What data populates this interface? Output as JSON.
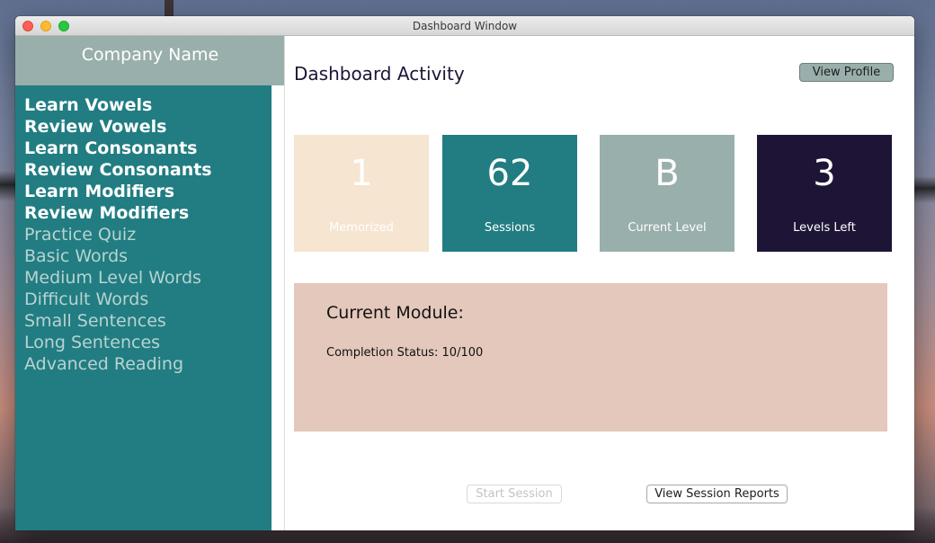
{
  "window": {
    "title": "Dashboard Window"
  },
  "sidebar": {
    "company_name": "Company Name",
    "items": [
      {
        "label": "Learn Vowels",
        "state": "active"
      },
      {
        "label": "Review Vowels",
        "state": "active"
      },
      {
        "label": "Learn Consonants",
        "state": "active"
      },
      {
        "label": "Review Consonants",
        "state": "active"
      },
      {
        "label": "Learn Modifiers",
        "state": "active"
      },
      {
        "label": "Review Modifiers",
        "state": "active"
      },
      {
        "label": "Practice Quiz",
        "state": "inactive"
      },
      {
        "label": "Basic Words",
        "state": "inactive"
      },
      {
        "label": "Medium Level Words",
        "state": "inactive"
      },
      {
        "label": "Difficult Words",
        "state": "inactive"
      },
      {
        "label": "Small Sentences",
        "state": "inactive"
      },
      {
        "label": "Long Sentences",
        "state": "inactive"
      },
      {
        "label": "Advanced Reading",
        "state": "inactive"
      }
    ]
  },
  "main": {
    "title": "Dashboard Activity",
    "view_profile_label": "View Profile",
    "stats": [
      {
        "value": "1",
        "label": "Memorized"
      },
      {
        "value": "62",
        "label": "Sessions"
      },
      {
        "value": "B",
        "label": "Current Level"
      },
      {
        "value": "3",
        "label": "Levels Left"
      }
    ],
    "module": {
      "title": "Current Module:",
      "status": "Completion Status: 10/100"
    },
    "start_session_label": "Start Session",
    "view_reports_label": "View Session Reports"
  },
  "colors": {
    "teal": "#217d82",
    "sage": "#99afab",
    "cream": "#f6e5d0",
    "navy": "#1e1536",
    "module_bg": "#e3c8bb"
  }
}
